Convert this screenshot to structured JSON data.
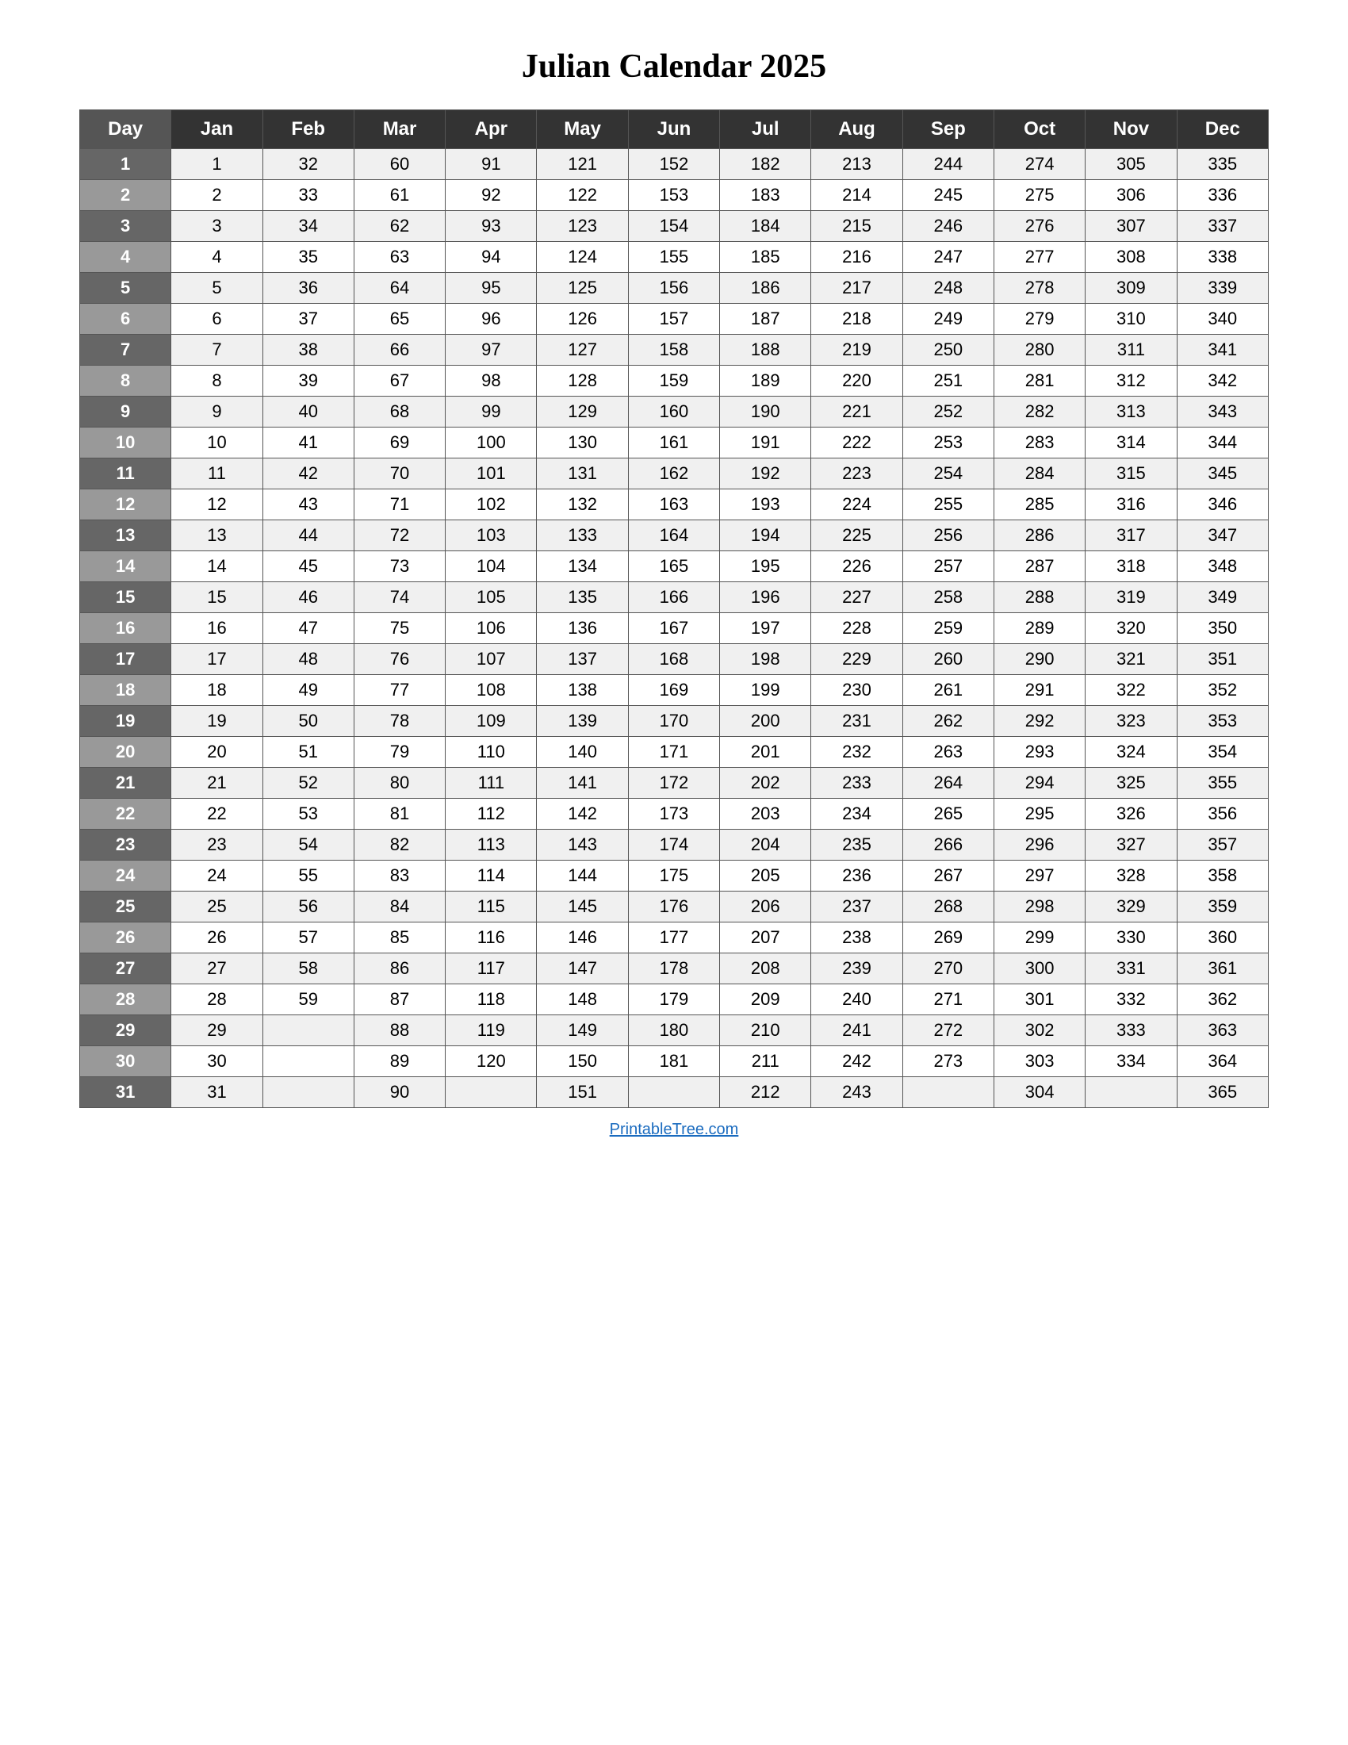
{
  "title": "Julian Calendar 2025",
  "footer_link": "PrintableTree.com",
  "columns": [
    "Day",
    "Jan",
    "Feb",
    "Mar",
    "Apr",
    "May",
    "Jun",
    "Jul",
    "Aug",
    "Sep",
    "Oct",
    "Nov",
    "Dec"
  ],
  "rows": [
    {
      "day": 1,
      "Jan": 1,
      "Feb": 32,
      "Mar": 60,
      "Apr": 91,
      "May": 121,
      "Jun": 152,
      "Jul": 182,
      "Aug": 213,
      "Sep": 244,
      "Oct": 274,
      "Nov": 305,
      "Dec": 335
    },
    {
      "day": 2,
      "Jan": 2,
      "Feb": 33,
      "Mar": 61,
      "Apr": 92,
      "May": 122,
      "Jun": 153,
      "Jul": 183,
      "Aug": 214,
      "Sep": 245,
      "Oct": 275,
      "Nov": 306,
      "Dec": 336
    },
    {
      "day": 3,
      "Jan": 3,
      "Feb": 34,
      "Mar": 62,
      "Apr": 93,
      "May": 123,
      "Jun": 154,
      "Jul": 184,
      "Aug": 215,
      "Sep": 246,
      "Oct": 276,
      "Nov": 307,
      "Dec": 337
    },
    {
      "day": 4,
      "Jan": 4,
      "Feb": 35,
      "Mar": 63,
      "Apr": 94,
      "May": 124,
      "Jun": 155,
      "Jul": 185,
      "Aug": 216,
      "Sep": 247,
      "Oct": 277,
      "Nov": 308,
      "Dec": 338
    },
    {
      "day": 5,
      "Jan": 5,
      "Feb": 36,
      "Mar": 64,
      "Apr": 95,
      "May": 125,
      "Jun": 156,
      "Jul": 186,
      "Aug": 217,
      "Sep": 248,
      "Oct": 278,
      "Nov": 309,
      "Dec": 339
    },
    {
      "day": 6,
      "Jan": 6,
      "Feb": 37,
      "Mar": 65,
      "Apr": 96,
      "May": 126,
      "Jun": 157,
      "Jul": 187,
      "Aug": 218,
      "Sep": 249,
      "Oct": 279,
      "Nov": 310,
      "Dec": 340
    },
    {
      "day": 7,
      "Jan": 7,
      "Feb": 38,
      "Mar": 66,
      "Apr": 97,
      "May": 127,
      "Jun": 158,
      "Jul": 188,
      "Aug": 219,
      "Sep": 250,
      "Oct": 280,
      "Nov": 311,
      "Dec": 341
    },
    {
      "day": 8,
      "Jan": 8,
      "Feb": 39,
      "Mar": 67,
      "Apr": 98,
      "May": 128,
      "Jun": 159,
      "Jul": 189,
      "Aug": 220,
      "Sep": 251,
      "Oct": 281,
      "Nov": 312,
      "Dec": 342
    },
    {
      "day": 9,
      "Jan": 9,
      "Feb": 40,
      "Mar": 68,
      "Apr": 99,
      "May": 129,
      "Jun": 160,
      "Jul": 190,
      "Aug": 221,
      "Sep": 252,
      "Oct": 282,
      "Nov": 313,
      "Dec": 343
    },
    {
      "day": 10,
      "Jan": 10,
      "Feb": 41,
      "Mar": 69,
      "Apr": 100,
      "May": 130,
      "Jun": 161,
      "Jul": 191,
      "Aug": 222,
      "Sep": 253,
      "Oct": 283,
      "Nov": 314,
      "Dec": 344
    },
    {
      "day": 11,
      "Jan": 11,
      "Feb": 42,
      "Mar": 70,
      "Apr": 101,
      "May": 131,
      "Jun": 162,
      "Jul": 192,
      "Aug": 223,
      "Sep": 254,
      "Oct": 284,
      "Nov": 315,
      "Dec": 345
    },
    {
      "day": 12,
      "Jan": 12,
      "Feb": 43,
      "Mar": 71,
      "Apr": 102,
      "May": 132,
      "Jun": 163,
      "Jul": 193,
      "Aug": 224,
      "Sep": 255,
      "Oct": 285,
      "Nov": 316,
      "Dec": 346
    },
    {
      "day": 13,
      "Jan": 13,
      "Feb": 44,
      "Mar": 72,
      "Apr": 103,
      "May": 133,
      "Jun": 164,
      "Jul": 194,
      "Aug": 225,
      "Sep": 256,
      "Oct": 286,
      "Nov": 317,
      "Dec": 347
    },
    {
      "day": 14,
      "Jan": 14,
      "Feb": 45,
      "Mar": 73,
      "Apr": 104,
      "May": 134,
      "Jun": 165,
      "Jul": 195,
      "Aug": 226,
      "Sep": 257,
      "Oct": 287,
      "Nov": 318,
      "Dec": 348
    },
    {
      "day": 15,
      "Jan": 15,
      "Feb": 46,
      "Mar": 74,
      "Apr": 105,
      "May": 135,
      "Jun": 166,
      "Jul": 196,
      "Aug": 227,
      "Sep": 258,
      "Oct": 288,
      "Nov": 319,
      "Dec": 349
    },
    {
      "day": 16,
      "Jan": 16,
      "Feb": 47,
      "Mar": 75,
      "Apr": 106,
      "May": 136,
      "Jun": 167,
      "Jul": 197,
      "Aug": 228,
      "Sep": 259,
      "Oct": 289,
      "Nov": 320,
      "Dec": 350
    },
    {
      "day": 17,
      "Jan": 17,
      "Feb": 48,
      "Mar": 76,
      "Apr": 107,
      "May": 137,
      "Jun": 168,
      "Jul": 198,
      "Aug": 229,
      "Sep": 260,
      "Oct": 290,
      "Nov": 321,
      "Dec": 351
    },
    {
      "day": 18,
      "Jan": 18,
      "Feb": 49,
      "Mar": 77,
      "Apr": 108,
      "May": 138,
      "Jun": 169,
      "Jul": 199,
      "Aug": 230,
      "Sep": 261,
      "Oct": 291,
      "Nov": 322,
      "Dec": 352
    },
    {
      "day": 19,
      "Jan": 19,
      "Feb": 50,
      "Mar": 78,
      "Apr": 109,
      "May": 139,
      "Jun": 170,
      "Jul": 200,
      "Aug": 231,
      "Sep": 262,
      "Oct": 292,
      "Nov": 323,
      "Dec": 353
    },
    {
      "day": 20,
      "Jan": 20,
      "Feb": 51,
      "Mar": 79,
      "Apr": 110,
      "May": 140,
      "Jun": 171,
      "Jul": 201,
      "Aug": 232,
      "Sep": 263,
      "Oct": 293,
      "Nov": 324,
      "Dec": 354
    },
    {
      "day": 21,
      "Jan": 21,
      "Feb": 52,
      "Mar": 80,
      "Apr": 111,
      "May": 141,
      "Jun": 172,
      "Jul": 202,
      "Aug": 233,
      "Sep": 264,
      "Oct": 294,
      "Nov": 325,
      "Dec": 355
    },
    {
      "day": 22,
      "Jan": 22,
      "Feb": 53,
      "Mar": 81,
      "Apr": 112,
      "May": 142,
      "Jun": 173,
      "Jul": 203,
      "Aug": 234,
      "Sep": 265,
      "Oct": 295,
      "Nov": 326,
      "Dec": 356
    },
    {
      "day": 23,
      "Jan": 23,
      "Feb": 54,
      "Mar": 82,
      "Apr": 113,
      "May": 143,
      "Jun": 174,
      "Jul": 204,
      "Aug": 235,
      "Sep": 266,
      "Oct": 296,
      "Nov": 327,
      "Dec": 357
    },
    {
      "day": 24,
      "Jan": 24,
      "Feb": 55,
      "Mar": 83,
      "Apr": 114,
      "May": 144,
      "Jun": 175,
      "Jul": 205,
      "Aug": 236,
      "Sep": 267,
      "Oct": 297,
      "Nov": 328,
      "Dec": 358
    },
    {
      "day": 25,
      "Jan": 25,
      "Feb": 56,
      "Mar": 84,
      "Apr": 115,
      "May": 145,
      "Jun": 176,
      "Jul": 206,
      "Aug": 237,
      "Sep": 268,
      "Oct": 298,
      "Nov": 329,
      "Dec": 359
    },
    {
      "day": 26,
      "Jan": 26,
      "Feb": 57,
      "Mar": 85,
      "Apr": 116,
      "May": 146,
      "Jun": 177,
      "Jul": 207,
      "Aug": 238,
      "Sep": 269,
      "Oct": 299,
      "Nov": 330,
      "Dec": 360
    },
    {
      "day": 27,
      "Jan": 27,
      "Feb": 58,
      "Mar": 86,
      "Apr": 117,
      "May": 147,
      "Jun": 178,
      "Jul": 208,
      "Aug": 239,
      "Sep": 270,
      "Oct": 300,
      "Nov": 331,
      "Dec": 361
    },
    {
      "day": 28,
      "Jan": 28,
      "Feb": 59,
      "Mar": 87,
      "Apr": 118,
      "May": 148,
      "Jun": 179,
      "Jul": 209,
      "Aug": 240,
      "Sep": 271,
      "Oct": 301,
      "Nov": 332,
      "Dec": 362
    },
    {
      "day": 29,
      "Jan": 29,
      "Feb": "",
      "Mar": 88,
      "Apr": 119,
      "May": 149,
      "Jun": 180,
      "Jul": 210,
      "Aug": 241,
      "Sep": 272,
      "Oct": 302,
      "Nov": 333,
      "Dec": 363
    },
    {
      "day": 30,
      "Jan": 30,
      "Feb": "",
      "Mar": 89,
      "Apr": 120,
      "May": 150,
      "Jun": 181,
      "Jul": 211,
      "Aug": 242,
      "Sep": 273,
      "Oct": 303,
      "Nov": 334,
      "Dec": 364
    },
    {
      "day": 31,
      "Jan": 31,
      "Feb": "",
      "Mar": 90,
      "Apr": "",
      "May": 151,
      "Jun": "",
      "Jul": 212,
      "Aug": 243,
      "Sep": "",
      "Oct": 304,
      "Nov": "",
      "Dec": 365
    }
  ]
}
